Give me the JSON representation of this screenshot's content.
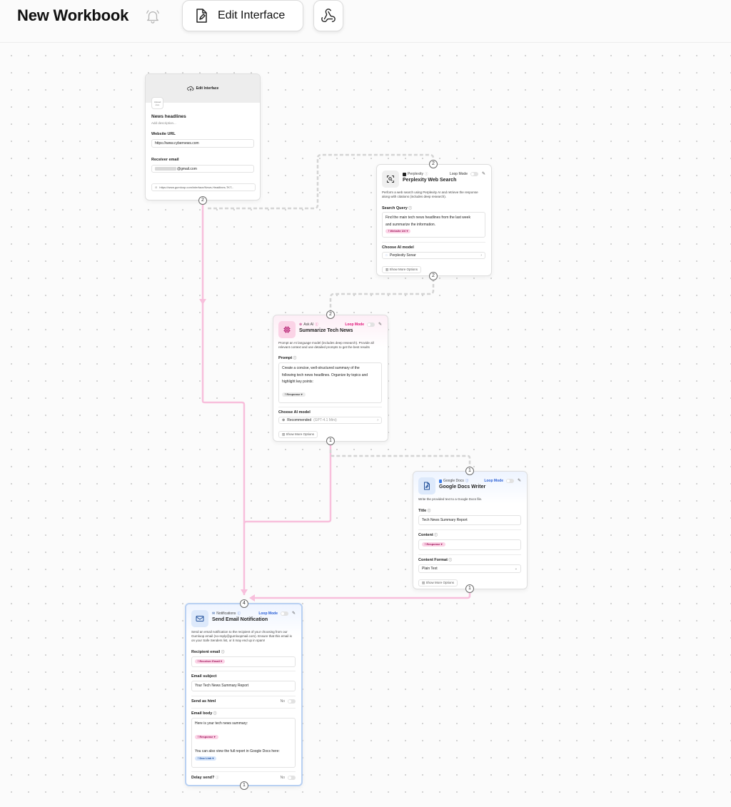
{
  "header": {
    "title": "New Workbook",
    "edit_interface_label": "Edit Interface"
  },
  "interface_card": {
    "banner_label": "Edit Interface",
    "upload_label_1": "Upload",
    "upload_label_2": "icon",
    "name": "News headlines",
    "description_placeholder": "Add description...",
    "website_url_label": "Website URL",
    "website_url_value": "https://www.cybernews.com",
    "receiver_email_label": "Receiver email",
    "receiver_email_value": "@gmail.com",
    "link": "https://www.gumloop.com/interface/News-Headlines-TKT..."
  },
  "perplexity_card": {
    "service": "Perplexity",
    "title": "Perplexity Web Search",
    "loop_mode": "Loop Mode",
    "description": "Perform a web search using Perplexity AI and retrieve the response along with citations (includes deep research).",
    "query_label": "Search Query",
    "query_line1": "Find the main tech news headlines from the last week",
    "query_line2": "and summarize the information.",
    "query_chip": "Website Url",
    "model_label": "Choose AI model",
    "model_value": "Perplexity Sonar",
    "more_options": "Show More Options"
  },
  "ask_ai_card": {
    "service": "Ask AI",
    "title": "Summarize Tech News",
    "loop_mode": "Loop Mode",
    "description": "Prompt an AI language model (includes deep research). Provide all relevant context and use detailed prompts to get the best results",
    "prompt_label": "Prompt",
    "prompt_line1": "Create a concise, well-structured summary of the",
    "prompt_line2": "following tech news headlines. Organize by topics and",
    "prompt_line3": "highlight key points:",
    "prompt_chip": "Response",
    "model_label": "Choose AI model",
    "model_value": "Recommended",
    "model_sub": "(GPT-4.1 Mini)",
    "more_options": "Show More Options"
  },
  "gdocs_card": {
    "service": "Google Docs",
    "title": "Google Docs Writer",
    "loop_mode": "Loop Mode",
    "description": "Write the provided text to a Google Docs file.",
    "title_label": "Title",
    "title_value": "Tech News Summary Report",
    "content_label": "Content",
    "content_chip": "Response",
    "format_label": "Content Format",
    "format_value": "Plain Text",
    "more_options": "Show More Options"
  },
  "email_card": {
    "service": "Notifications",
    "title": "Send Email Notification",
    "loop_mode": "Loop Mode",
    "description": "Send an email notification to the recipient of your choosing from our Gumloop email (no-reply@gumloopmail.com). Ensure that this email is on your Safe Senders list, or it may end up in spam!",
    "recipient_label": "Recipient email",
    "recipient_chip": "Receiver Email",
    "subject_label": "Email subject",
    "subject_value": "Your Tech News Summary Report",
    "html_label": "Send as html",
    "html_value": "No",
    "body_label": "Email body",
    "body_line1": "Here is your tech news summary:",
    "body_chip1": "Response",
    "body_line2": "You can also view the full report in Google Docs here:",
    "body_chip2": "Doc Link",
    "delay_label": "Delay send?",
    "delay_value": "No"
  },
  "badges": {
    "interface_out": "2",
    "perplexity_in": "2",
    "perplexity_out": "2",
    "ask_in": "2",
    "ask_out": "1",
    "gdocs_in": "1",
    "gdocs_out": "1",
    "email_in": "4",
    "email_out": "1"
  },
  "colors": {
    "accent_pink": "#f7b7d8",
    "wire_grey": "#d4d4d4",
    "loop_pink": "#e0157a",
    "loop_blue": "#2a5fd6"
  }
}
